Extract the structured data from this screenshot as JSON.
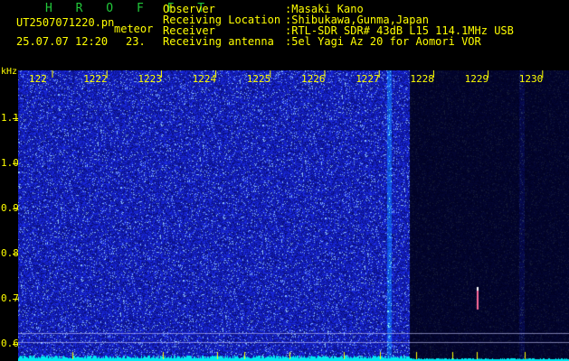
{
  "header": {
    "brand": "H R O F F T",
    "filename": "UT2507071220.pn",
    "tag": "meteor",
    "datetime": "25.07.07 12:20",
    "counter": "23.",
    "info": [
      {
        "label": "Observer",
        "value": ":Masaki Kano"
      },
      {
        "label": "Receiving Location",
        "value": ":Shibukawa,Gunma,Japan"
      },
      {
        "label": "Receiver",
        "value": ":RTL-SDR SDR# 43dB L15 114.1MHz USB"
      },
      {
        "label": "Receiving antenna",
        "value": ":5el Yagi Az 20 for Aomori VOR"
      }
    ]
  },
  "axis": {
    "unit": "kHz",
    "top_ticks": [
      "122",
      "1222",
      "1223",
      "1224",
      "1225",
      "1226",
      "1227",
      "1228",
      "1229",
      "1230"
    ],
    "left_ticks": [
      "1.1",
      "1.0",
      "0.9",
      "0.8",
      "0.7",
      "0.6"
    ]
  },
  "colors": {
    "background": "#000000",
    "header_text": "#ffff00",
    "brand": "#22c83a",
    "waterfall_noise": "#1f2bd0",
    "waterfall_dark": "#0a0f5a",
    "baseline": "#00e8f0"
  }
}
